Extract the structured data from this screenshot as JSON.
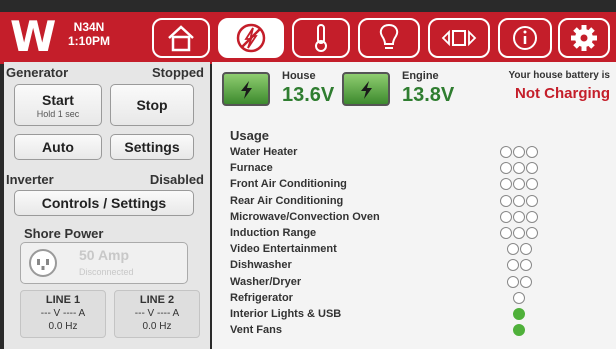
{
  "header": {
    "logo_letter": "W",
    "site_code": "N34N",
    "time": "1:10PM",
    "nav_icons": [
      "home-icon",
      "no-power-icon",
      "thermometer-icon",
      "light-bulb-icon",
      "plug-icon",
      "info-icon",
      "gear-icon"
    ]
  },
  "generator": {
    "label": "Generator",
    "status": "Stopped",
    "start_label": "Start",
    "start_hint": "Hold 1 sec",
    "stop_label": "Stop",
    "auto_label": "Auto",
    "settings_label": "Settings"
  },
  "inverter": {
    "label": "Inverter",
    "status": "Disabled",
    "controls_label": "Controls / Settings"
  },
  "shore": {
    "label": "Shore Power",
    "amp": "50 Amp",
    "status": "Disconnected"
  },
  "lines": [
    {
      "title": "LINE 1",
      "va": "--- V   ---- A",
      "hz": "0.0 Hz"
    },
    {
      "title": "LINE 2",
      "va": "--- V   ---- A",
      "hz": "0.0 Hz"
    }
  ],
  "batteries": {
    "house": {
      "label": "House",
      "voltage": "13.6V"
    },
    "engine": {
      "label": "Engine",
      "voltage": "13.8V"
    },
    "charge_title": "Your house battery is",
    "charge_status": "Not Charging"
  },
  "usage": {
    "title": "Usage",
    "items": [
      {
        "label": "Water Heater",
        "dots": 3,
        "on": 0
      },
      {
        "label": "Furnace",
        "dots": 3,
        "on": 0
      },
      {
        "label": "Front Air Conditioning",
        "dots": 3,
        "on": 0
      },
      {
        "label": "Rear Air Conditioning",
        "dots": 3,
        "on": 0
      },
      {
        "label": "Microwave/Convection Oven",
        "dots": 3,
        "on": 0
      },
      {
        "label": "Induction Range",
        "dots": 3,
        "on": 0
      },
      {
        "label": "Video Entertainment",
        "dots": 2,
        "on": 0
      },
      {
        "label": "Dishwasher",
        "dots": 2,
        "on": 0
      },
      {
        "label": "Washer/Dryer",
        "dots": 2,
        "on": 0
      },
      {
        "label": "Refrigerator",
        "dots": 1,
        "on": 0
      },
      {
        "label": "Interior Lights & USB",
        "dots": 1,
        "on": 1
      },
      {
        "label": "Vent Fans",
        "dots": 1,
        "on": 1
      }
    ]
  },
  "colors": {
    "brand_red": "#c41e2a",
    "green": "#4fb03a",
    "volt_green": "#2f7d30"
  }
}
